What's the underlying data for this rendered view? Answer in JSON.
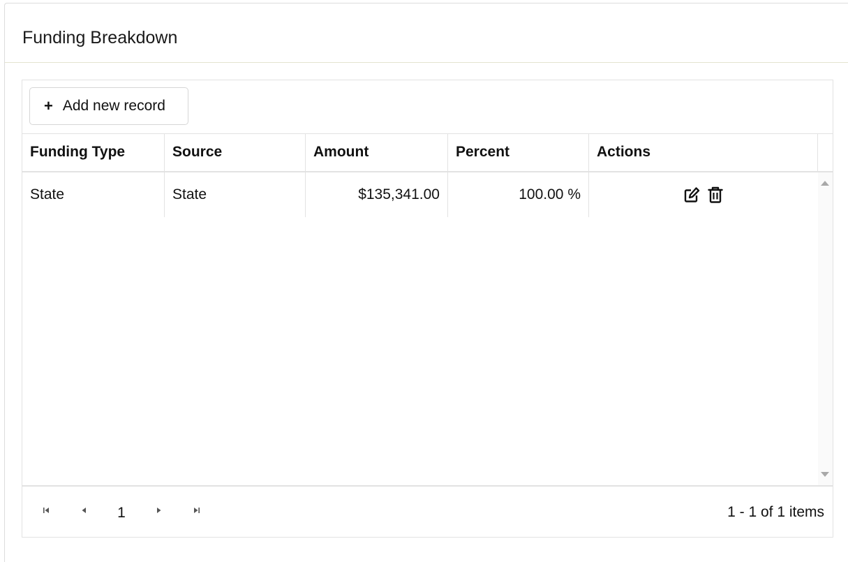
{
  "panel": {
    "title": "Funding Breakdown"
  },
  "toolbar": {
    "add_icon": "+",
    "add_label": "Add new record"
  },
  "grid": {
    "columns": [
      "Funding Type",
      "Source",
      "Amount",
      "Percent",
      "Actions"
    ],
    "rows": [
      {
        "funding_type": "State",
        "source": "State",
        "amount": "$135,341.00",
        "percent": "100.00 %"
      }
    ]
  },
  "icons": {
    "edit": "edit-icon",
    "delete": "trash-icon",
    "first": "first-page-icon",
    "prev": "previous-page-icon",
    "next": "next-page-icon",
    "last": "last-page-icon"
  },
  "pager": {
    "current_page": "1",
    "info": "1 - 1 of 1 items"
  },
  "colors": {
    "border": "#e2e2e2",
    "header_divider": "#e3e3cf",
    "text": "#111111"
  }
}
